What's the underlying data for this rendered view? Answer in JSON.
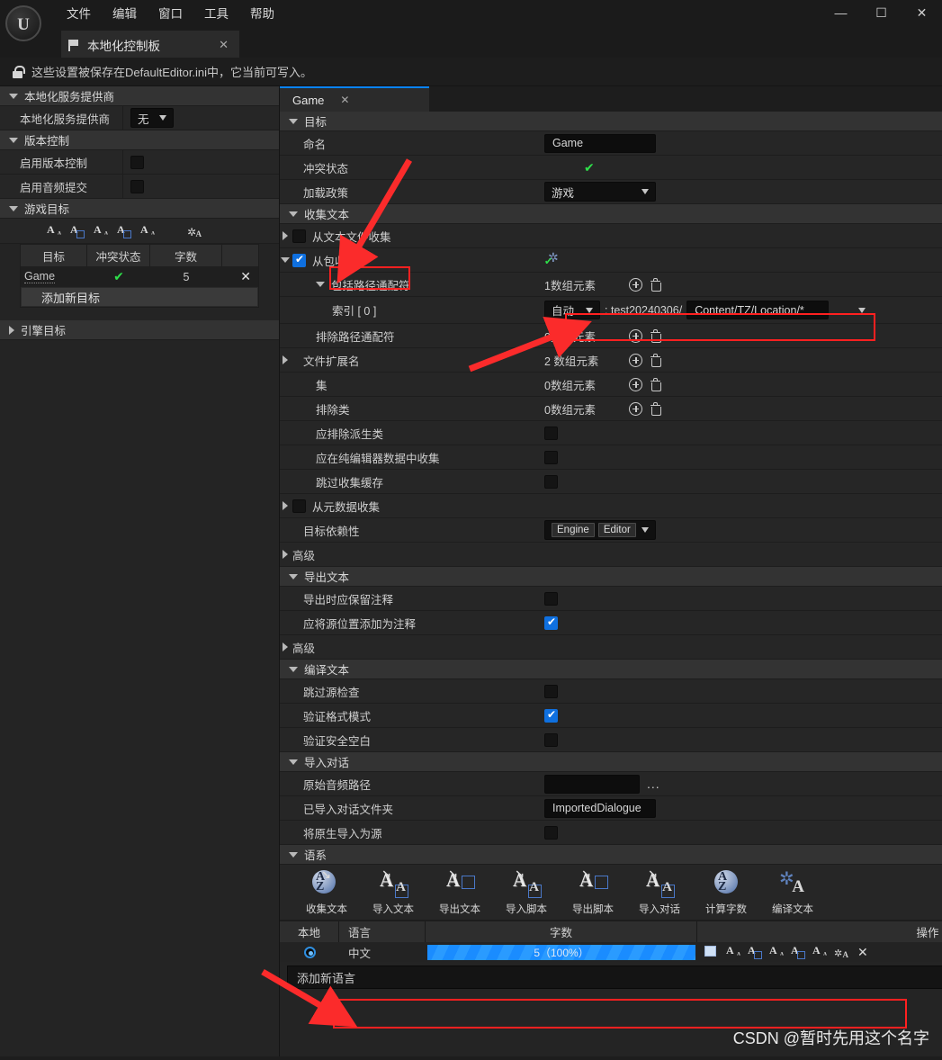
{
  "window": {
    "logo": "UE",
    "menus": [
      "文件",
      "编辑",
      "窗口",
      "工具",
      "帮助"
    ],
    "controls": {
      "minimize": "—",
      "maximize": "☐",
      "close": "✕"
    },
    "tab": {
      "title": "本地化控制板",
      "close": "✕",
      "icon": "flag-icon"
    },
    "info_bar": {
      "icon": "unlock-icon",
      "text": "这些设置被保存在DefaultEditor.ini中，它当前可写入。"
    }
  },
  "sidebar": {
    "sections": [
      {
        "title": "本地化服务提供商",
        "expanded": true,
        "rows": [
          {
            "label": "本地化服务提供商",
            "control": "combo",
            "value": "无"
          }
        ]
      },
      {
        "title": "版本控制",
        "expanded": true,
        "rows": [
          {
            "label": "启用版本控制",
            "control": "checkbox",
            "checked": false
          },
          {
            "label": "启用音频提交",
            "control": "checkbox",
            "checked": false
          }
        ]
      }
    ],
    "game_targets": {
      "title": "游戏目标",
      "expanded": true,
      "toolbar_icons": [
        "collect-text-icon",
        "import-text-icon",
        "export-text-icon",
        "import-script-icon",
        "export-script-icon",
        "import-dialogue-icon",
        "count-words-icon",
        "compile-text-icon"
      ],
      "columns": [
        "目标",
        "冲突状态",
        "字数"
      ],
      "rows": [
        {
          "target": "Game",
          "conflict": "✔",
          "words": "5",
          "remove": "✕"
        }
      ],
      "add_button": "添加新目标"
    },
    "engine_targets": {
      "title": "引擎目标",
      "expanded": false
    }
  },
  "main": {
    "tab": {
      "label": "Game",
      "close": "✕"
    },
    "sections": [
      {
        "id": "target",
        "title": "目标"
      },
      {
        "id": "gather",
        "title": "收集文本"
      },
      {
        "id": "export",
        "title": "导出文本"
      },
      {
        "id": "compile",
        "title": "编译文本"
      },
      {
        "id": "import_dialogue",
        "title": "导入对话"
      },
      {
        "id": "cultures",
        "title": "语系"
      }
    ],
    "target_rows": [
      {
        "label": "命名",
        "control": "textbox",
        "value": "Game"
      },
      {
        "label": "冲突状态",
        "control": "check-mark",
        "value": "✔"
      },
      {
        "label": "加载政策",
        "control": "combo",
        "value": "游戏"
      }
    ],
    "gather_rows": [
      {
        "label": "从文本文件收集",
        "control": "checkbox",
        "checked": false,
        "expandable": true,
        "expanded": false,
        "indent": 0
      },
      {
        "label": "从包收集",
        "control": "checkbox",
        "checked": true,
        "expandable": true,
        "expanded": true,
        "indent": 0,
        "icon": "gears-check-icon",
        "highlighted": true
      },
      {
        "label": "包括路径通配符",
        "control": "array",
        "value": "1数组元素",
        "expandable": true,
        "expanded": true,
        "indent": 1
      },
      {
        "label": "索引 [ 0 ]",
        "control": "path-entry",
        "indent": 2,
        "path_mode": "自动",
        "path_prefix": ": test20240306/",
        "path_value": "Content/TZ/Location/*",
        "ellipsis": "...",
        "highlighted": true
      },
      {
        "label": "排除路径通配符",
        "control": "array",
        "value": "0数组元素",
        "indent": 1
      },
      {
        "label": "文件扩展名",
        "control": "array",
        "value": "2 数组元素",
        "expandable": true,
        "expanded": false,
        "indent": 1
      },
      {
        "label": "集",
        "control": "array",
        "value": "0数组元素",
        "indent": 1
      },
      {
        "label": "排除类",
        "control": "array",
        "value": "0数组元素",
        "indent": 1
      },
      {
        "label": "应排除派生类",
        "control": "checkbox",
        "checked": false,
        "indent": 1
      },
      {
        "label": "应在纯编辑器数据中收集",
        "control": "checkbox",
        "checked": false,
        "indent": 1
      },
      {
        "label": "跳过收集缓存",
        "control": "checkbox",
        "checked": false,
        "indent": 1
      },
      {
        "label": "从元数据收集",
        "control": "checkbox",
        "checked": false,
        "expandable": true,
        "expanded": false,
        "indent": 0
      },
      {
        "label": "目标依赖性",
        "control": "chips",
        "chips": [
          "Engine",
          "Editor"
        ],
        "indent": 0
      },
      {
        "label": "高级",
        "control": "subsection",
        "expanded": false,
        "indent": 0
      }
    ],
    "export_rows": [
      {
        "label": "导出时应保留注释",
        "control": "checkbox",
        "checked": false
      },
      {
        "label": "应将源位置添加为注释",
        "control": "checkbox",
        "checked": true
      },
      {
        "label": "高级",
        "control": "subsection",
        "expanded": false
      }
    ],
    "compile_rows": [
      {
        "label": "跳过源检查",
        "control": "checkbox",
        "checked": false
      },
      {
        "label": "验证格式模式",
        "control": "checkbox",
        "checked": true
      },
      {
        "label": "验证安全空白",
        "control": "checkbox",
        "checked": false
      }
    ],
    "import_dialogue_rows": [
      {
        "label": "原始音频路径",
        "control": "textbox-browse",
        "value": "",
        "ellipsis": "..."
      },
      {
        "label": "已导入对话文件夹",
        "control": "textbox",
        "value": "ImportedDialogue"
      },
      {
        "label": "将原生导入为源",
        "control": "checkbox",
        "checked": false
      }
    ],
    "culture_actions": [
      {
        "label": "收集文本",
        "icon": "collect-text-icon"
      },
      {
        "label": "导入文本",
        "icon": "import-text-icon"
      },
      {
        "label": "导出文本",
        "icon": "export-text-icon"
      },
      {
        "label": "导入脚本",
        "icon": "import-script-icon"
      },
      {
        "label": "导出脚本",
        "icon": "export-script-icon"
      },
      {
        "label": "导入对话",
        "icon": "import-dialogue-icon"
      },
      {
        "label": "计算字数",
        "icon": "count-words-icon"
      },
      {
        "label": "编译文本",
        "icon": "compile-text-icon"
      }
    ],
    "culture_table": {
      "columns": [
        "本地",
        "语言",
        "字数",
        "操作"
      ],
      "rows": [
        {
          "native": "radio-selected",
          "language": "中文",
          "words": "5（100%）",
          "progress_percent": 100,
          "actions": [
            "open-folder-icon",
            "import-text-icon",
            "export-text-icon",
            "import-script-icon",
            "export-script-icon",
            "import-dialogue-icon",
            "compile-text-icon"
          ],
          "delete": "✕"
        }
      ],
      "add_language": {
        "label": "添加新语言",
        "highlighted": true
      }
    }
  },
  "annotations": {
    "watermark": "CSDN @暂时先用这个名字",
    "highlight_color": "#ff2020",
    "arrow_color": "#fb2b2b"
  },
  "colors": {
    "accent_blue": "#0a84ff",
    "progress_blue": "#1a8cff",
    "check_green": "#2ee04a",
    "panel_bg": "#242424",
    "section_header": "#333333"
  }
}
